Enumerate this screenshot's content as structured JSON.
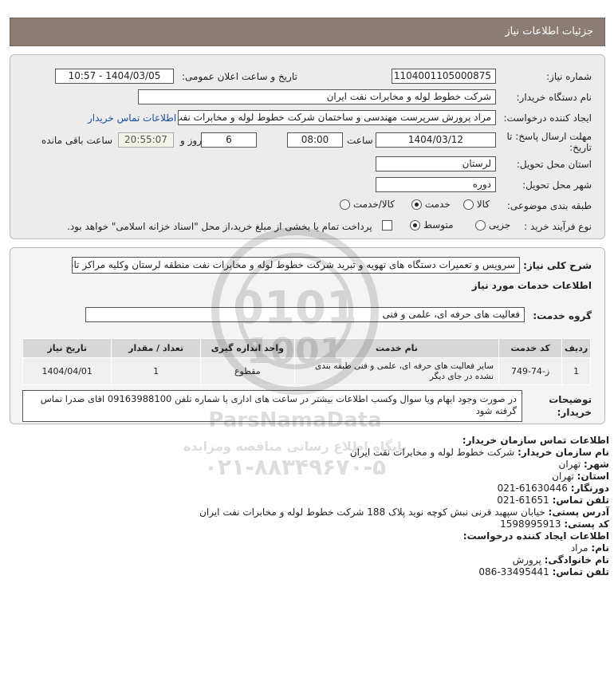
{
  "header": {
    "title": "جزئیات اطلاعات نیاز"
  },
  "form": {
    "need_number_label": "شماره نیاز:",
    "need_number": "1104001105000875",
    "announce_label": "تاریخ و ساعت اعلان عمومی:",
    "announce_value": "1404/03/05 - 10:57",
    "buyer_org_label": "نام دستگاه خریدار:",
    "buyer_org": "شرکت خطوط لوله و مخابرات نفت ایران",
    "creator_label": "ایجاد کننده درخواست:",
    "creator": "مراد پرورش سرپرست مهندسی و ساختمان  شرکت خطوط لوله و مخابرات نفت",
    "buyer_contact_link": "اطلاعات تماس خریدار",
    "deadline_label_1": "مهلت ارسال پاسخ: تا",
    "deadline_label_2": "تاریخ:",
    "deadline_date": "1404/03/12",
    "time_label": "ساعت",
    "deadline_time": "08:00",
    "days_value": "6",
    "days_label": "روز و",
    "remaining_time": "20:55:07",
    "remaining_label": "ساعت باقی مانده",
    "province_label": "استان محل تحویل:",
    "province": "لرستان",
    "city_label": "شهر محل تحویل:",
    "city": "دوره",
    "category_label": "طبقه بندی موضوعی:",
    "category_options": [
      "کالا",
      "خدمت",
      "کالا/خدمت"
    ],
    "category_selected": "خدمت",
    "process_label": "نوع فرآیند خرید :",
    "process_options": [
      "جزیی",
      "متوسط"
    ],
    "process_selected": "متوسط",
    "payment_note": "پرداخت تمام یا بخشی از مبلغ خرید،از محل \"اسناد خزانه اسلامی\" خواهد بود."
  },
  "details": {
    "description_label": "شرح کلی نیاز:",
    "description": "سرویس و تعمیرات دستگاه های تهویه و تبرید شرکت خطوط لوله و مخابرات نفت منطقه لرستان وکلیه مراکز تابعه",
    "services_heading": "اطلاعات خدمات مورد نیاز",
    "service_group_label": "گروه خدمت:",
    "service_group": "فعالیت های حرفه ای، علمی و فنی",
    "table_headers": [
      "ردیف",
      "کد خدمت",
      "نام خدمت",
      "واحد اندازه گیری",
      "تعداد / مقدار",
      "تاریخ نیاز"
    ],
    "table_rows": [
      [
        "1",
        "ز-74-749",
        "سایر فعالیت های حرفه ای، علمی و فنی طبقه بندی نشده در جای دیگر",
        "مقطوع",
        "1",
        "1404/04/01"
      ]
    ],
    "buyer_notes_label_1": "توضیحات",
    "buyer_notes_label_2": "خریدار:",
    "buyer_notes": "در صورت وجود ابهام ویا سوال وکسب اطلاعات بیشتر در ساعت های اداری با شماره تلفن 09163988100 اقای صدرا تماس گرفته شود"
  },
  "contact": {
    "heading": "اطلاعات تماس سازمان خریدار:",
    "org_label": "نام سازمان خریدار:",
    "org": "شرکت خطوط لوله و مخابرات نفت ایران",
    "city_label": "شهر:",
    "city": "تهران",
    "province_label": "استان:",
    "province": "تهران",
    "fax_label": "دورنگار:",
    "fax": "61630446-021",
    "phone_label": "تلفن تماس:",
    "phone": "61651-021",
    "address_label": "آدرس پستی:",
    "address": "خیابان سپهبد قرنی نبش کوچه نوید پلاک 188 شرکت خطوط لوله و مخابرات نفت ایران",
    "postal_label": "کد پستی:",
    "postal": "1598995913",
    "creator_heading": "اطلاعات ایجاد کننده درخواست:",
    "name_label": "نام:",
    "name": "مراد",
    "family_label": "نام خانوادگی:",
    "family": "پرورش",
    "creator_phone_label": "تلفن تماس:",
    "creator_phone": "33495441-086"
  },
  "watermark": {
    "text_en": "ParsNamaData",
    "text_fa": "پایگاه اطلاع رسانی مناقصه ومزایده",
    "phone": "۰۲۱-۸۸۳۴۹۶۷۰-۵"
  }
}
